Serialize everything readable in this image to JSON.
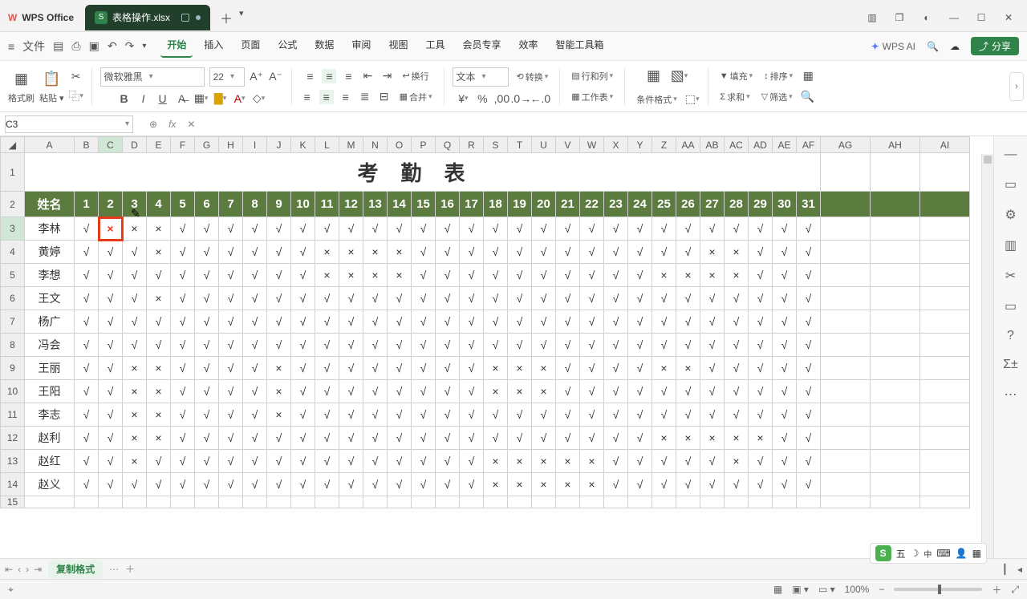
{
  "app": {
    "name": "WPS Office"
  },
  "tab": {
    "icon_letter": "S",
    "filename": "表格操作.xlsx"
  },
  "menu": {
    "items": [
      "开始",
      "插入",
      "页面",
      "公式",
      "数据",
      "审阅",
      "视图",
      "工具",
      "会员专享",
      "效率",
      "智能工具箱"
    ],
    "active": "开始",
    "file_label": "文件",
    "ai_label": "WPS AI",
    "share_label": "分享"
  },
  "ribbon": {
    "format_painter": "格式刷",
    "paste": "粘贴",
    "font_name": "微软雅黑",
    "font_size": "22",
    "wrap": "换行",
    "merge": "合并",
    "numfmt": "文本",
    "convert": "转换",
    "rowcol": "行和列",
    "worksheet": "工作表",
    "cond_fmt": "条件格式",
    "fill": "填充",
    "sort": "排序",
    "sum": "求和",
    "filter": "筛选"
  },
  "fbar": {
    "cell_ref": "C3",
    "formula": ""
  },
  "columns": [
    "A",
    "B",
    "C",
    "D",
    "E",
    "F",
    "G",
    "H",
    "I",
    "J",
    "K",
    "L",
    "M",
    "N",
    "O",
    "P",
    "Q",
    "R",
    "S",
    "T",
    "U",
    "V",
    "W",
    "X",
    "Y",
    "Z",
    "AA",
    "AB",
    "AC",
    "AD",
    "AE",
    "AF",
    "AG",
    "AH",
    "AI"
  ],
  "rows_visible": 15,
  "selected": {
    "col": "C",
    "row": 3
  },
  "sheet": {
    "title": "考勤表",
    "name_header": "姓名",
    "days": 31,
    "check": "√",
    "cross": "×",
    "people": [
      {
        "name": "李林",
        "absent": [
          2,
          3,
          4
        ]
      },
      {
        "name": "黄婷",
        "absent": [
          4,
          11,
          12,
          13,
          14,
          27,
          28
        ]
      },
      {
        "name": "李想",
        "absent": [
          11,
          12,
          13,
          14,
          25,
          26,
          27,
          28
        ]
      },
      {
        "name": "王文",
        "absent": [
          4
        ]
      },
      {
        "name": "杨广",
        "absent": []
      },
      {
        "name": "冯会",
        "absent": []
      },
      {
        "name": "王丽",
        "absent": [
          3,
          4,
          9,
          18,
          19,
          20,
          25,
          26
        ]
      },
      {
        "name": "王阳",
        "absent": [
          3,
          4,
          9,
          18,
          19,
          20
        ]
      },
      {
        "name": "李志",
        "absent": [
          3,
          4,
          9
        ]
      },
      {
        "name": "赵利",
        "absent": [
          3,
          4,
          25,
          26,
          27,
          28,
          29
        ]
      },
      {
        "name": "赵红",
        "absent": [
          3,
          18,
          19,
          20,
          21,
          22,
          28
        ]
      },
      {
        "name": "赵义",
        "absent": [
          18,
          19,
          20,
          21,
          22
        ]
      }
    ]
  },
  "sheet_tab": {
    "name": "复制格式"
  },
  "status": {
    "zoom": "100%",
    "ime": {
      "label1": "五",
      "label2": "中"
    }
  }
}
